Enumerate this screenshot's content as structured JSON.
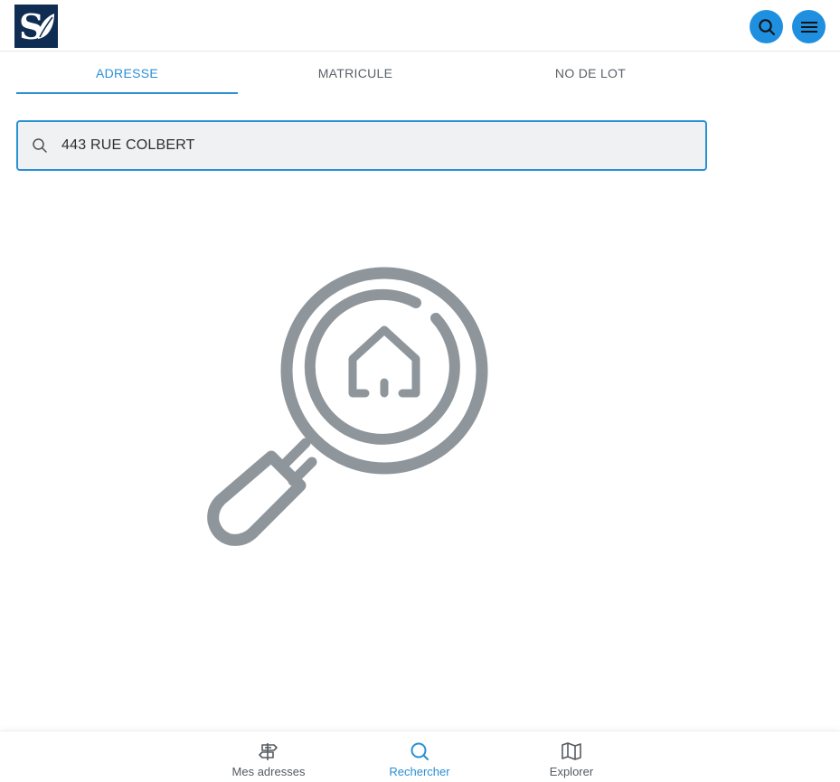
{
  "header": {
    "logo_text": "S",
    "search_icon": "search-icon",
    "menu_icon": "hamburger-menu-icon"
  },
  "tabs": [
    {
      "label": "ADRESSE",
      "active": true
    },
    {
      "label": "MATRICULE",
      "active": false
    },
    {
      "label": "NO DE LOT",
      "active": false
    }
  ],
  "search": {
    "value": "443 RUE COLBERT",
    "placeholder": ""
  },
  "empty_state": {
    "icon": "house-magnifier-icon"
  },
  "bottom_nav": [
    {
      "label": "Mes adresses",
      "icon": "signpost-icon",
      "active": false
    },
    {
      "label": "Rechercher",
      "icon": "search-icon",
      "active": true
    },
    {
      "label": "Explorer",
      "icon": "map-icon",
      "active": false
    }
  ],
  "colors": {
    "accent": "#2a90d4",
    "header_button": "#1f8fe0",
    "logo_bg": "#0f2d52",
    "illustration": "#8f969b"
  }
}
